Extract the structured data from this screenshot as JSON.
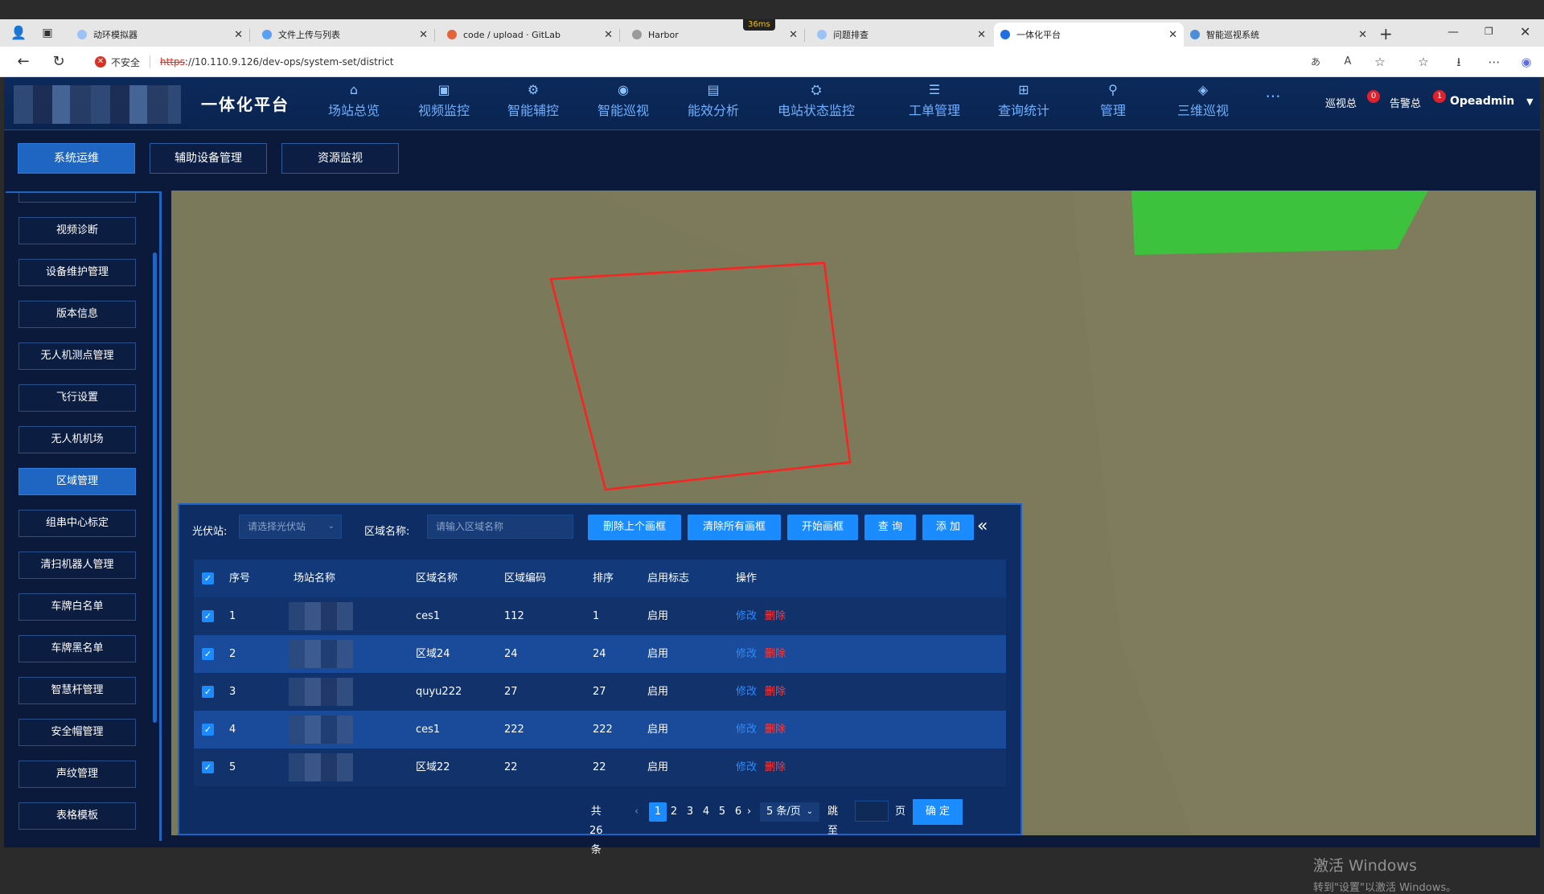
{
  "browser": {
    "tabs": [
      {
        "label": "动环模拟器",
        "color": "#9cc3f5"
      },
      {
        "label": "文件上传与列表",
        "color": "#5aa0f0"
      },
      {
        "label": "code / upload · GitLab",
        "color": "#e2643b"
      },
      {
        "label": "Harbor",
        "color": "#9a9a9a"
      },
      {
        "label": "问题排查",
        "color": "#9cc3f5"
      },
      {
        "label": "一体化平台",
        "color": "#1f6fe0"
      },
      {
        "label": "智能巡视系统",
        "color": "#4d8fd6"
      }
    ],
    "network_indicator": "36ms",
    "url_insecure_label": "不安全",
    "url_scheme": "https",
    "url_rest": "://10.110.9.126/dev-ops/system-set/district"
  },
  "header": {
    "title": "一体化平台",
    "nav": [
      {
        "label": "场站总览",
        "icon": "home-icon"
      },
      {
        "label": "视频监控",
        "icon": "video-icon"
      },
      {
        "label": "智能辅控",
        "icon": "control-icon"
      },
      {
        "label": "智能巡视",
        "icon": "inspection-icon"
      },
      {
        "label": "能效分析",
        "icon": "analysis-icon"
      },
      {
        "label": "电站状态监控",
        "icon": "status-icon"
      },
      {
        "label": "工单管理",
        "icon": "workorder-icon"
      },
      {
        "label": "查询统计",
        "icon": "query-icon"
      },
      {
        "label": "管理",
        "icon": "location-icon"
      },
      {
        "label": "三维巡视",
        "icon": "3d-icon"
      },
      {
        "label": "···",
        "icon": ""
      }
    ],
    "stats": [
      {
        "label": "巡视总",
        "badge": "0"
      },
      {
        "label": "告警总",
        "badge": "1"
      }
    ],
    "user": "Opeadmin"
  },
  "subtabs": [
    "系统运维",
    "辅助设备管理",
    "资源监视"
  ],
  "sidebar": {
    "items": [
      "视频诊断",
      "设备维护管理",
      "版本信息",
      "无人机测点管理",
      "飞行设置",
      "无人机机场",
      "区域管理",
      "组串中心标定",
      "清扫机器人管理",
      "车牌白名单",
      "车牌黑名单",
      "智慧杆管理",
      "安全帽管理",
      "声纹管理",
      "表格模板"
    ],
    "active": "区域管理"
  },
  "filter": {
    "station_label": "光伏站:",
    "station_placeholder": "请选择光伏站",
    "area_label": "区域名称:",
    "area_placeholder": "请输入区域名称",
    "buttons": [
      "删除上个画框",
      "清除所有画框",
      "开始画框",
      "查 询",
      "添 加"
    ]
  },
  "table": {
    "headers": [
      "序号",
      "场站名称",
      "区域名称",
      "区域编码",
      "排序",
      "启用标志",
      "操作"
    ],
    "rows": [
      {
        "idx": "1",
        "area": "ces1",
        "code": "112",
        "sort": "1",
        "status": "启用"
      },
      {
        "idx": "2",
        "area": "区域24",
        "code": "24",
        "sort": "24",
        "status": "启用"
      },
      {
        "idx": "3",
        "area": "quyu222",
        "code": "27",
        "sort": "27",
        "status": "启用"
      },
      {
        "idx": "4",
        "area": "ces1",
        "code": "222",
        "sort": "222",
        "status": "启用"
      },
      {
        "idx": "5",
        "area": "区域22",
        "code": "22",
        "sort": "22",
        "status": "启用"
      }
    ],
    "edit_label": "修改",
    "delete_label": "删除"
  },
  "pagination": {
    "total": "共 26 条",
    "pages": [
      "1",
      "2",
      "3",
      "4",
      "5",
      "6"
    ],
    "current": "1",
    "page_size": "5 条/页",
    "jump_label": "跳至",
    "page_unit": "页",
    "confirm": "确 定"
  },
  "watermark": {
    "line1": "激活 Windows",
    "line2": "转到\"设置\"以激活 Windows。"
  },
  "colors": {
    "accent": "#1a8cff",
    "map_bg": "#7c7a5a",
    "drawn_box": "#ff2020",
    "green_region": "#3cc23c"
  }
}
